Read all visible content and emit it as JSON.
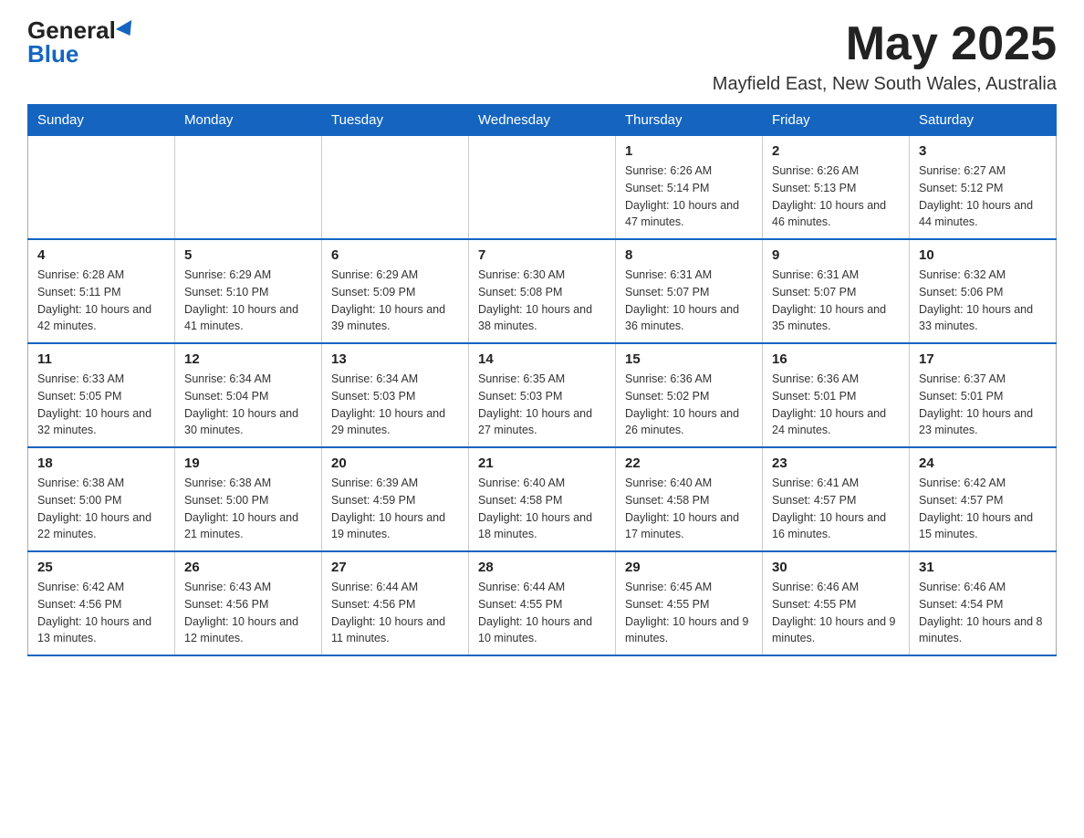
{
  "logo": {
    "general": "General",
    "blue": "Blue"
  },
  "header": {
    "month": "May 2025",
    "location": "Mayfield East, New South Wales, Australia"
  },
  "weekdays": [
    "Sunday",
    "Monday",
    "Tuesday",
    "Wednesday",
    "Thursday",
    "Friday",
    "Saturday"
  ],
  "weeks": [
    [
      {
        "day": "",
        "info": ""
      },
      {
        "day": "",
        "info": ""
      },
      {
        "day": "",
        "info": ""
      },
      {
        "day": "",
        "info": ""
      },
      {
        "day": "1",
        "info": "Sunrise: 6:26 AM\nSunset: 5:14 PM\nDaylight: 10 hours and 47 minutes."
      },
      {
        "day": "2",
        "info": "Sunrise: 6:26 AM\nSunset: 5:13 PM\nDaylight: 10 hours and 46 minutes."
      },
      {
        "day": "3",
        "info": "Sunrise: 6:27 AM\nSunset: 5:12 PM\nDaylight: 10 hours and 44 minutes."
      }
    ],
    [
      {
        "day": "4",
        "info": "Sunrise: 6:28 AM\nSunset: 5:11 PM\nDaylight: 10 hours and 42 minutes."
      },
      {
        "day": "5",
        "info": "Sunrise: 6:29 AM\nSunset: 5:10 PM\nDaylight: 10 hours and 41 minutes."
      },
      {
        "day": "6",
        "info": "Sunrise: 6:29 AM\nSunset: 5:09 PM\nDaylight: 10 hours and 39 minutes."
      },
      {
        "day": "7",
        "info": "Sunrise: 6:30 AM\nSunset: 5:08 PM\nDaylight: 10 hours and 38 minutes."
      },
      {
        "day": "8",
        "info": "Sunrise: 6:31 AM\nSunset: 5:07 PM\nDaylight: 10 hours and 36 minutes."
      },
      {
        "day": "9",
        "info": "Sunrise: 6:31 AM\nSunset: 5:07 PM\nDaylight: 10 hours and 35 minutes."
      },
      {
        "day": "10",
        "info": "Sunrise: 6:32 AM\nSunset: 5:06 PM\nDaylight: 10 hours and 33 minutes."
      }
    ],
    [
      {
        "day": "11",
        "info": "Sunrise: 6:33 AM\nSunset: 5:05 PM\nDaylight: 10 hours and 32 minutes."
      },
      {
        "day": "12",
        "info": "Sunrise: 6:34 AM\nSunset: 5:04 PM\nDaylight: 10 hours and 30 minutes."
      },
      {
        "day": "13",
        "info": "Sunrise: 6:34 AM\nSunset: 5:03 PM\nDaylight: 10 hours and 29 minutes."
      },
      {
        "day": "14",
        "info": "Sunrise: 6:35 AM\nSunset: 5:03 PM\nDaylight: 10 hours and 27 minutes."
      },
      {
        "day": "15",
        "info": "Sunrise: 6:36 AM\nSunset: 5:02 PM\nDaylight: 10 hours and 26 minutes."
      },
      {
        "day": "16",
        "info": "Sunrise: 6:36 AM\nSunset: 5:01 PM\nDaylight: 10 hours and 24 minutes."
      },
      {
        "day": "17",
        "info": "Sunrise: 6:37 AM\nSunset: 5:01 PM\nDaylight: 10 hours and 23 minutes."
      }
    ],
    [
      {
        "day": "18",
        "info": "Sunrise: 6:38 AM\nSunset: 5:00 PM\nDaylight: 10 hours and 22 minutes."
      },
      {
        "day": "19",
        "info": "Sunrise: 6:38 AM\nSunset: 5:00 PM\nDaylight: 10 hours and 21 minutes."
      },
      {
        "day": "20",
        "info": "Sunrise: 6:39 AM\nSunset: 4:59 PM\nDaylight: 10 hours and 19 minutes."
      },
      {
        "day": "21",
        "info": "Sunrise: 6:40 AM\nSunset: 4:58 PM\nDaylight: 10 hours and 18 minutes."
      },
      {
        "day": "22",
        "info": "Sunrise: 6:40 AM\nSunset: 4:58 PM\nDaylight: 10 hours and 17 minutes."
      },
      {
        "day": "23",
        "info": "Sunrise: 6:41 AM\nSunset: 4:57 PM\nDaylight: 10 hours and 16 minutes."
      },
      {
        "day": "24",
        "info": "Sunrise: 6:42 AM\nSunset: 4:57 PM\nDaylight: 10 hours and 15 minutes."
      }
    ],
    [
      {
        "day": "25",
        "info": "Sunrise: 6:42 AM\nSunset: 4:56 PM\nDaylight: 10 hours and 13 minutes."
      },
      {
        "day": "26",
        "info": "Sunrise: 6:43 AM\nSunset: 4:56 PM\nDaylight: 10 hours and 12 minutes."
      },
      {
        "day": "27",
        "info": "Sunrise: 6:44 AM\nSunset: 4:56 PM\nDaylight: 10 hours and 11 minutes."
      },
      {
        "day": "28",
        "info": "Sunrise: 6:44 AM\nSunset: 4:55 PM\nDaylight: 10 hours and 10 minutes."
      },
      {
        "day": "29",
        "info": "Sunrise: 6:45 AM\nSunset: 4:55 PM\nDaylight: 10 hours and 9 minutes."
      },
      {
        "day": "30",
        "info": "Sunrise: 6:46 AM\nSunset: 4:55 PM\nDaylight: 10 hours and 9 minutes."
      },
      {
        "day": "31",
        "info": "Sunrise: 6:46 AM\nSunset: 4:54 PM\nDaylight: 10 hours and 8 minutes."
      }
    ]
  ]
}
